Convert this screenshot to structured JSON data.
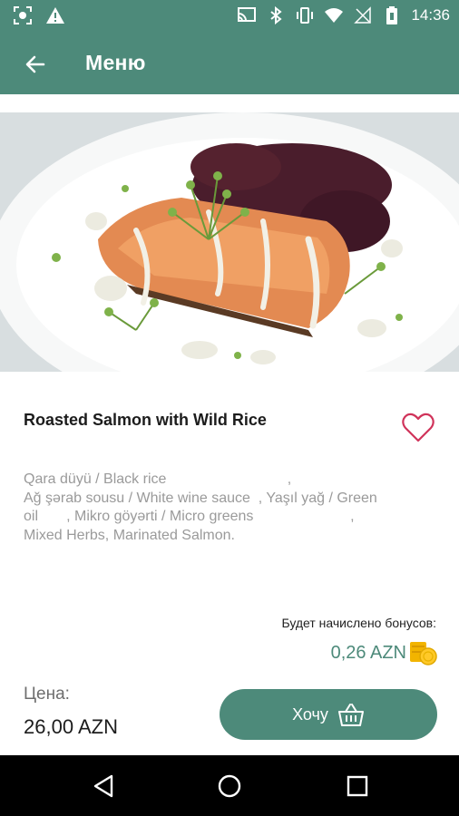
{
  "status_bar": {
    "time": "14:36",
    "icons_left": [
      "screen-record-icon",
      "warning-icon"
    ],
    "icons_right": [
      "cast-icon",
      "bluetooth-icon",
      "vibrate-icon",
      "wifi-icon",
      "no-signal-icon",
      "battery-icon"
    ]
  },
  "app_bar": {
    "title": "Меню",
    "back_icon": "arrow-left-icon"
  },
  "dish": {
    "name": "Roasted Salmon with Wild Rice",
    "ingredients_line1": "Qara düyü / Black rice                              ,",
    "ingredients_line2": "Ağ şərab sousu / White wine sauce  , Yaşıl yağ / Green",
    "ingredients_line3": "oil       , Mikro göyərti / Micro greens                        ,",
    "ingredients_line4": "Mixed Herbs, Marinated Salmon.",
    "favorite_icon": "heart-outline-icon"
  },
  "bonus": {
    "label": "Будет начислено бонусов:",
    "value": "0,26 AZN",
    "icon": "coins-icon"
  },
  "price": {
    "label": "Цена:",
    "value": "26,00 AZN"
  },
  "action": {
    "want_label": "Хочу",
    "icon": "basket-icon"
  },
  "colors": {
    "accent": "#4d8a7a",
    "heart": "#d0335a",
    "coin": "#f2b400"
  },
  "nav_bar": {
    "buttons": [
      "back-triangle-icon",
      "home-circle-icon",
      "recents-square-icon"
    ]
  }
}
